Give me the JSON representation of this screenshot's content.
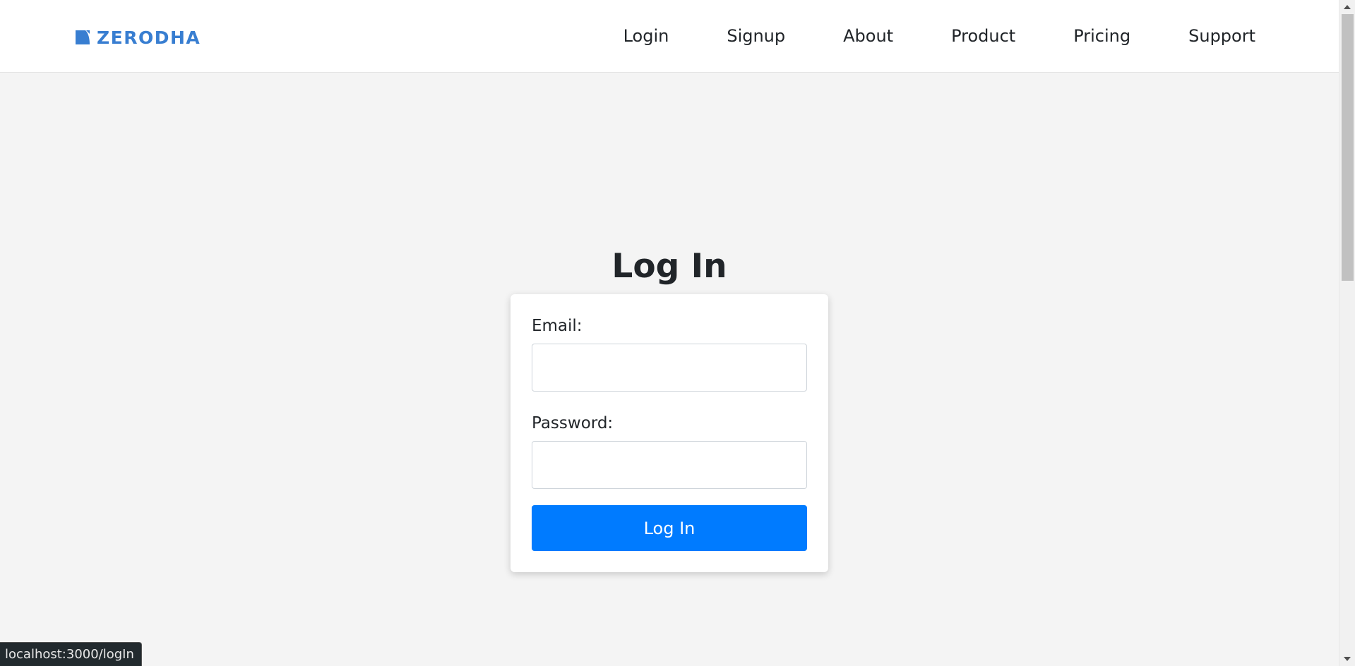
{
  "brand": {
    "name": "ZERODHA",
    "icon": "zerodha-logo-icon",
    "color": "#387ed1"
  },
  "nav": {
    "items": [
      {
        "label": "Login"
      },
      {
        "label": "Signup"
      },
      {
        "label": "About"
      },
      {
        "label": "Product"
      },
      {
        "label": "Pricing"
      },
      {
        "label": "Support"
      }
    ]
  },
  "main": {
    "title": "Log In",
    "form": {
      "email_label": "Email:",
      "email_value": "",
      "password_label": "Password:",
      "password_value": "",
      "submit_label": "Log In",
      "submit_color": "#007bff"
    }
  },
  "status_bar": {
    "url": "localhost:3000/logIn"
  }
}
